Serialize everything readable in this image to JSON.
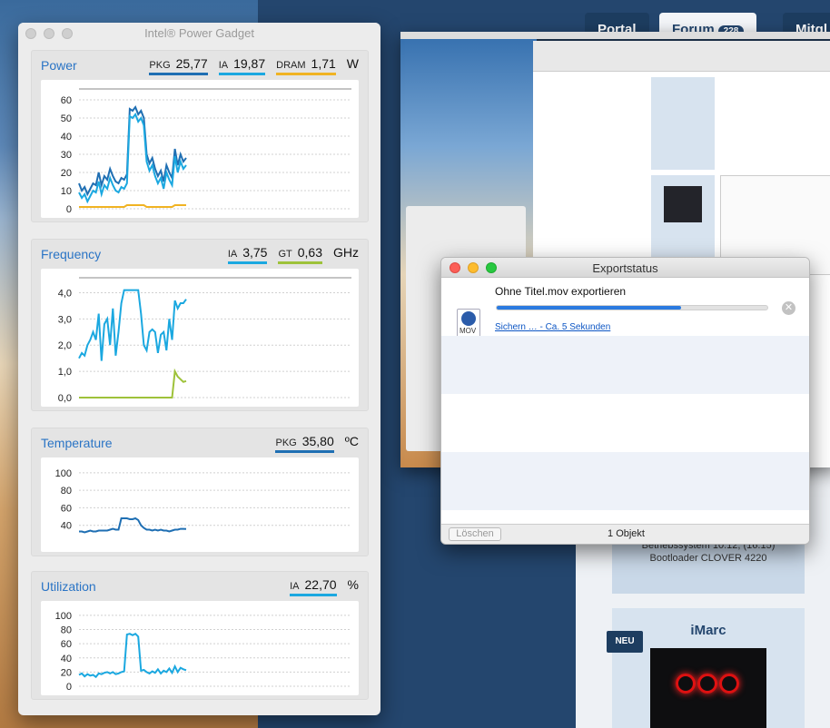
{
  "power_gadget": {
    "title": "Intel® Power Gadget",
    "power": {
      "title": "Power",
      "legend": [
        {
          "label": "PKG",
          "value": "25,77",
          "color": "#1f6fb3"
        },
        {
          "label": "IA",
          "value": "19,87",
          "color": "#1ba8e0"
        },
        {
          "label": "DRAM",
          "value": "1,71",
          "color": "#f0b323"
        }
      ],
      "unit": "W",
      "yticks": [
        "60",
        "50",
        "40",
        "30",
        "20",
        "10",
        "0"
      ]
    },
    "frequency": {
      "title": "Frequency",
      "legend": [
        {
          "label": "IA",
          "value": "3,75",
          "color": "#1ba8e0"
        },
        {
          "label": "GT",
          "value": "0,63",
          "color": "#9ec23a"
        }
      ],
      "unit": "GHz",
      "yticks": [
        "4,0",
        "3,0",
        "2,0",
        "1,0",
        "0,0"
      ]
    },
    "temperature": {
      "title": "Temperature",
      "legend": [
        {
          "label": "PKG",
          "value": "35,80",
          "color": "#1f6fb3"
        }
      ],
      "unit": "ºC",
      "yticks": [
        "100",
        "80",
        "60",
        "40"
      ]
    },
    "utilization": {
      "title": "Utilization",
      "legend": [
        {
          "label": "IA",
          "value": "22,70",
          "color": "#1ba8e0"
        }
      ],
      "unit": "%",
      "yticks": [
        "100",
        "80",
        "60",
        "40",
        "20",
        "0"
      ]
    }
  },
  "export_window": {
    "title": "Exportstatus",
    "filename": "Ohne Titel.mov exportieren",
    "progress_fraction": 0.68,
    "status": "Sichern … - Ca. 5 Sekunden",
    "icon_label": "MOV",
    "clear_button": "Löschen",
    "item_count": "1 Objekt"
  },
  "forum": {
    "tabs": [
      {
        "label": "Portal"
      },
      {
        "label": "Forum",
        "badge": "228"
      },
      {
        "label": "Mitgl"
      }
    ],
    "card_line_1": "Betriebssystem 10.12, (16.15)",
    "card_line_2": "Bootloader  CLOVER 4220",
    "new_badge": "NEU",
    "username": "iMarc"
  },
  "chart_data": [
    {
      "type": "line",
      "title": "Power",
      "ylim": [
        0,
        65
      ],
      "series": [
        {
          "name": "PKG",
          "values": [
            14,
            10,
            12,
            8,
            11,
            14,
            13,
            20,
            13,
            18,
            16,
            22,
            18,
            15,
            14,
            17,
            16,
            19,
            55,
            54,
            56,
            52,
            54,
            50,
            30,
            25,
            28,
            22,
            18,
            21,
            15,
            24,
            20,
            17,
            33,
            24,
            30,
            26,
            28
          ]
        },
        {
          "name": "IA",
          "values": [
            9,
            6,
            8,
            4,
            7,
            10,
            9,
            15,
            8,
            13,
            11,
            17,
            13,
            10,
            9,
            12,
            11,
            14,
            51,
            50,
            52,
            48,
            50,
            46,
            26,
            21,
            24,
            18,
            14,
            17,
            11,
            20,
            16,
            13,
            29,
            20,
            26,
            22,
            24
          ]
        },
        {
          "name": "DRAM",
          "values": [
            1,
            1,
            1,
            1,
            1,
            1,
            1,
            1,
            1,
            1,
            1,
            1,
            1,
            1,
            1,
            1,
            1,
            2,
            2,
            2,
            2,
            2,
            2,
            2,
            1,
            1,
            1,
            1,
            1,
            1,
            1,
            1,
            1,
            1,
            2,
            2,
            2,
            2,
            2
          ]
        }
      ]
    },
    {
      "type": "line",
      "title": "Frequency",
      "ylim": [
        0,
        4.5
      ],
      "series": [
        {
          "name": "IA",
          "values": [
            1.5,
            1.7,
            1.6,
            2.0,
            2.2,
            2.5,
            2.2,
            3.2,
            1.4,
            2.8,
            3.0,
            2.0,
            3.4,
            1.6,
            2.5,
            3.6,
            4.1,
            4.1,
            4.1,
            4.1,
            4.1,
            4.1,
            3.2,
            2.0,
            1.8,
            2.5,
            2.6,
            2.5,
            1.7,
            2.4,
            2.5,
            1.8,
            3.0,
            2.2,
            3.7,
            3.4,
            3.6,
            3.6,
            3.75
          ]
        },
        {
          "name": "GT",
          "values": [
            0,
            0,
            0,
            0,
            0,
            0,
            0,
            0,
            0,
            0,
            0,
            0,
            0,
            0,
            0,
            0,
            0,
            0,
            0,
            0,
            0,
            0,
            0,
            0,
            0,
            0,
            0,
            0,
            0,
            0,
            0,
            0,
            0,
            0,
            1.0,
            0.8,
            0.7,
            0.6,
            0.63
          ]
        }
      ]
    },
    {
      "type": "line",
      "title": "Temperature",
      "ylim": [
        20,
        105
      ],
      "series": [
        {
          "name": "PKG",
          "values": [
            33,
            33,
            32,
            33,
            34,
            33,
            33,
            34,
            34,
            34,
            34,
            35,
            36,
            35,
            35,
            48,
            48,
            48,
            47,
            47,
            48,
            46,
            40,
            37,
            35,
            35,
            34,
            35,
            34,
            35,
            34,
            34,
            33,
            34,
            35,
            35,
            36,
            36,
            35.8
          ]
        }
      ]
    },
    {
      "type": "line",
      "title": "Utilization",
      "ylim": [
        0,
        105
      ],
      "series": [
        {
          "name": "IA",
          "values": [
            16,
            18,
            14,
            17,
            15,
            16,
            13,
            18,
            17,
            19,
            20,
            18,
            20,
            17,
            18,
            20,
            21,
            73,
            74,
            72,
            74,
            70,
            22,
            23,
            20,
            18,
            21,
            19,
            24,
            18,
            22,
            20,
            25,
            19,
            28,
            20,
            26,
            24,
            22.7
          ]
        }
      ]
    }
  ]
}
